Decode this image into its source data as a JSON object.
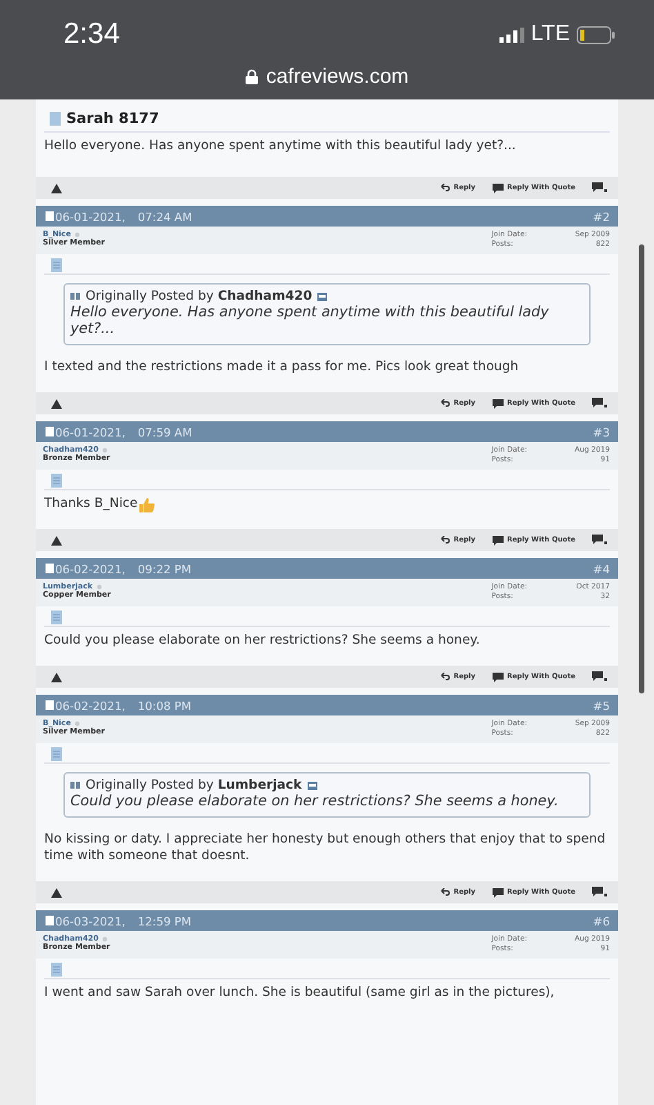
{
  "status_bar": {
    "time": "2:34",
    "network": "LTE"
  },
  "address_bar": {
    "url": "cafreviews.com"
  },
  "first_post": {
    "title": "Sarah 8177",
    "message": "Hello everyone. Has anyone spent anytime with this beautiful lady yet?...",
    "actions": {
      "reply": "Reply",
      "quote": "Reply With Quote"
    }
  },
  "posts": [
    {
      "date": "06-01-2021,",
      "time": "07:24 AM",
      "number": "#2",
      "username": "B_Nice",
      "rank": "Silver Member",
      "join_label": "Join Date:",
      "join_date": "Sep 2009",
      "posts_label": "Posts:",
      "posts_count": "822",
      "quote": {
        "prefix": "Originally Posted by",
        "author": "Chadham420",
        "text": "Hello everyone. Has anyone spent anytime with this beautiful lady yet?..."
      },
      "message": "I texted and the restrictions made it a pass for me. Pics look great though",
      "thumbs_up": false,
      "actions": {
        "reply": "Reply",
        "quote": "Reply With Quote"
      }
    },
    {
      "date": "06-01-2021,",
      "time": "07:59 AM",
      "number": "#3",
      "username": "Chadham420",
      "rank": "Bronze Member",
      "join_label": "Join Date:",
      "join_date": "Aug 2019",
      "posts_label": "Posts:",
      "posts_count": "91",
      "message": "Thanks B_Nice",
      "thumbs_up": true,
      "actions": {
        "reply": "Reply",
        "quote": "Reply With Quote"
      }
    },
    {
      "date": "06-02-2021,",
      "time": "09:22 PM",
      "number": "#4",
      "username": "Lumberjack",
      "rank": "Copper Member",
      "join_label": "Join Date:",
      "join_date": "Oct 2017",
      "posts_label": "Posts:",
      "posts_count": "32",
      "message": "Could you please elaborate on her restrictions? She seems a honey.",
      "thumbs_up": false,
      "actions": {
        "reply": "Reply",
        "quote": "Reply With Quote"
      }
    },
    {
      "date": "06-02-2021,",
      "time": "10:08 PM",
      "number": "#5",
      "username": "B_Nice",
      "rank": "Silver Member",
      "join_label": "Join Date:",
      "join_date": "Sep 2009",
      "posts_label": "Posts:",
      "posts_count": "822",
      "quote": {
        "prefix": "Originally Posted by",
        "author": "Lumberjack",
        "text": "Could you please elaborate on her restrictions? She seems a honey."
      },
      "message": "No kissing or daty. I appreciate her honesty but enough others that enjoy that to spend time with someone that doesnt.",
      "thumbs_up": false,
      "actions": {
        "reply": "Reply",
        "quote": "Reply With Quote"
      }
    },
    {
      "date": "06-03-2021,",
      "time": "12:59 PM",
      "number": "#6",
      "username": "Chadham420",
      "rank": "Bronze Member",
      "join_label": "Join Date:",
      "join_date": "Aug 2019",
      "posts_label": "Posts:",
      "posts_count": "91",
      "message": "I went and saw Sarah over lunch. She is beautiful (same girl as in the pictures),",
      "thumbs_up": false
    }
  ]
}
